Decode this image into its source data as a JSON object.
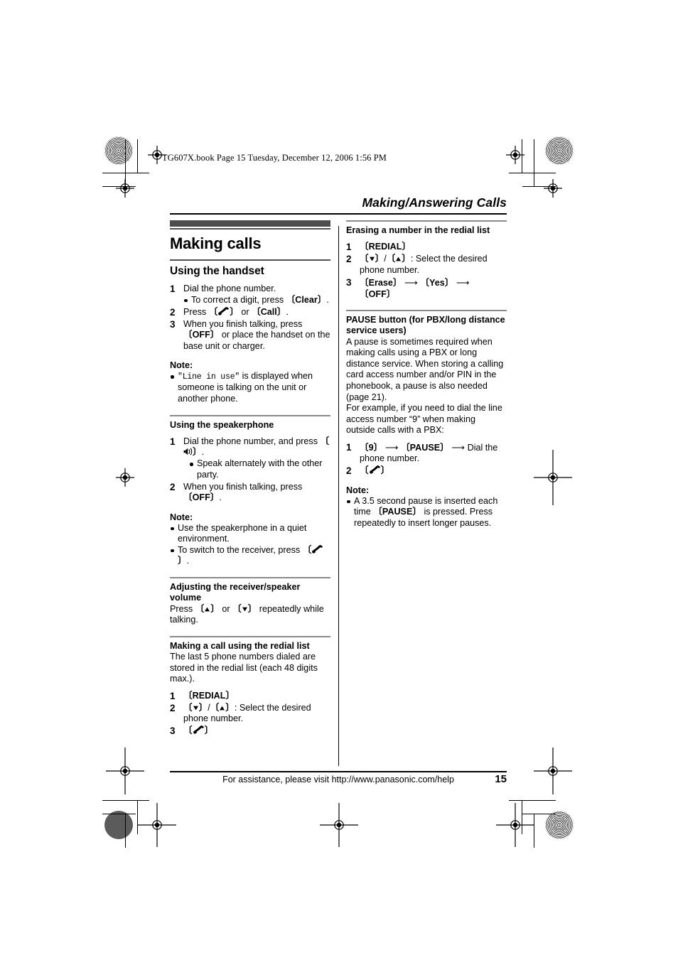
{
  "print": {
    "filename_line": "TG607X.book  Page 15  Tuesday, December 12, 2006  1:56 PM"
  },
  "header": {
    "running_head": "Making/Answering Calls"
  },
  "footer": {
    "assistance": "For assistance, please visit http://www.panasonic.com/help",
    "page_number": "15"
  },
  "left_column": {
    "chapter_title": "Making calls",
    "sections": [
      {
        "heading": "Using the handset",
        "steps": [
          {
            "num": "1",
            "text": "Dial the phone number.",
            "bullets": [
              {
                "pre": "To correct a digit, press ",
                "key": "{Clear}",
                "post": "."
              }
            ]
          },
          {
            "num": "2",
            "pre": "Press ",
            "icon": "handset-icon",
            "mid": " or ",
            "key": "{Call}",
            "post": "."
          },
          {
            "num": "3",
            "pre": "When you finish talking, press ",
            "key": "{OFF}",
            "post": " or place the handset on the base unit or charger."
          }
        ],
        "note_label": "Note:",
        "notes": [
          {
            "mono": "\"Line in use\"",
            "post": " is displayed when someone is talking on the unit or another phone."
          }
        ]
      },
      {
        "heading": "Using the speakerphone",
        "steps": [
          {
            "num": "1",
            "pre": "Dial the phone number, and press ",
            "icon": "speakerphone-icon",
            "post": ".",
            "bullets": [
              {
                "pre": "Speak alternately with the other party."
              }
            ]
          },
          {
            "num": "2",
            "pre": "When you finish talking, press ",
            "key": "{OFF}",
            "post": "."
          }
        ],
        "note_label": "Note:",
        "notes": [
          {
            "pre": "Use the speakerphone in a quiet environment."
          },
          {
            "pre": "To switch to the receiver, press ",
            "icon": "handset-icon",
            "post": "."
          }
        ]
      },
      {
        "heading": "Adjusting the receiver/speaker volume",
        "body_pre": "Press ",
        "body_mid": " or ",
        "body_post": " repeatedly while talking.",
        "icon_up": "volume-up-icon",
        "icon_down": "volume-down-icon"
      },
      {
        "heading": "Making a call using the redial list",
        "body": "The last 5 phone numbers dialed are stored in the redial list (each 48 digits max.).",
        "steps": [
          {
            "num": "1",
            "key": "{REDIAL}"
          },
          {
            "num": "2",
            "keys_nav": true,
            "post": ": Select the desired phone number."
          },
          {
            "num": "3",
            "icon_only": "handset-icon"
          }
        ]
      }
    ]
  },
  "right_column": {
    "sections": [
      {
        "heading": "Erasing a number in the redial list",
        "steps": [
          {
            "num": "1",
            "key": "{REDIAL}"
          },
          {
            "num": "2",
            "keys_nav": true,
            "post": ": Select the desired phone number."
          },
          {
            "num": "3",
            "chain": [
              "{Erase}",
              "{Yes}",
              "{OFF}"
            ]
          }
        ]
      },
      {
        "heading": "PAUSE button (for PBX/long distance service users)",
        "body": "A pause is sometimes required when making calls using a PBX or long distance service. When storing a calling card access number and/or PIN in the phonebook, a pause is also needed (page 21).",
        "body2": "For example, if you need to dial the line access number “9” when making outside calls with a PBX:",
        "steps": [
          {
            "num": "1",
            "chain3": [
              "{9}",
              "{PAUSE}"
            ],
            "tail": "Dial the phone number."
          },
          {
            "num": "2",
            "icon_only": "handset-icon"
          }
        ],
        "note_label": "Note:",
        "notes": [
          {
            "pre": "A 3.5 second pause is inserted each time ",
            "key": "{PAUSE}",
            "post": " is pressed. Press repeatedly to insert longer pauses."
          }
        ]
      }
    ]
  },
  "colors": {
    "bar_dark": "#4d4d4d",
    "rule_gray": "#8a8a8a",
    "text": "#000000"
  }
}
